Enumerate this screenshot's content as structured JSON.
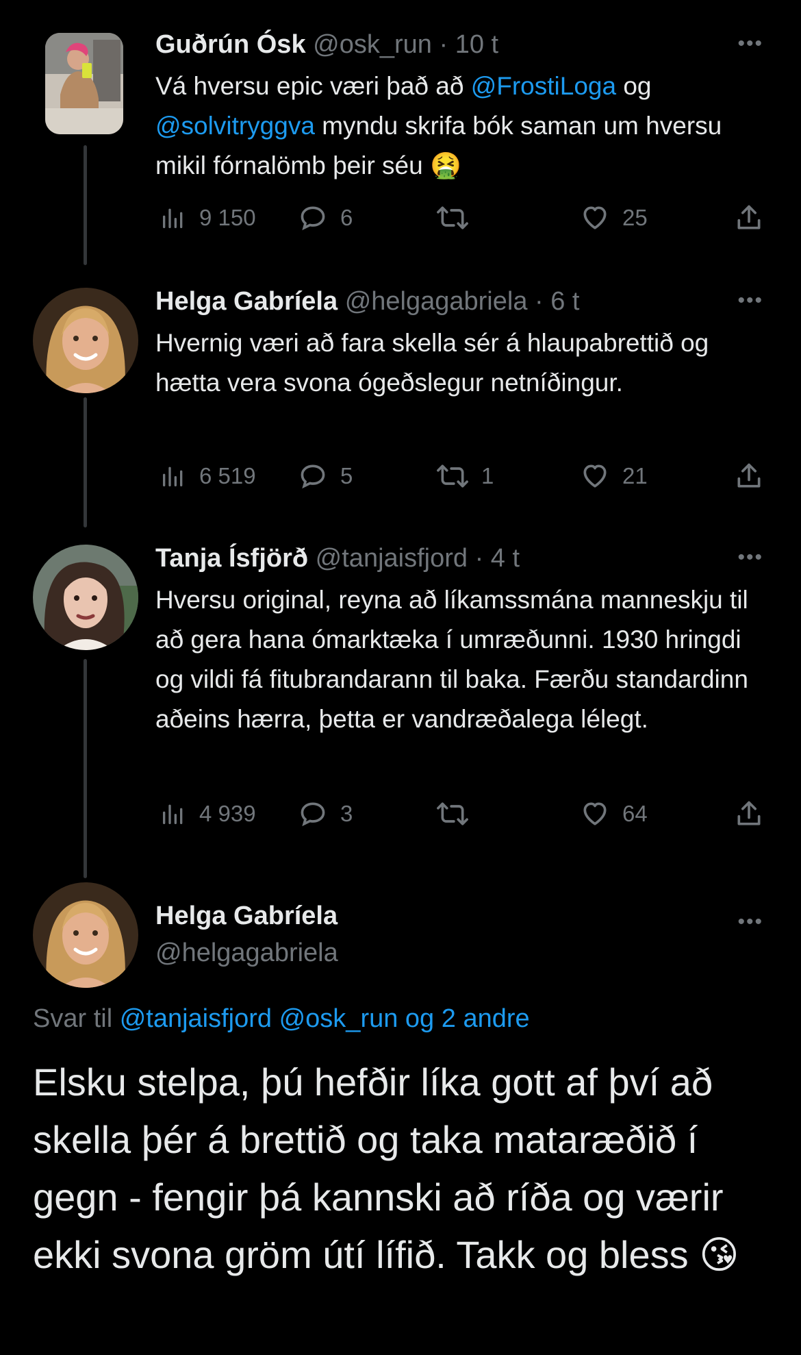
{
  "tweets": [
    {
      "name": "Guðrún Ósk",
      "handle": "@osk_run",
      "time": "10 t",
      "text_parts": [
        "Vá hversu epic væri það að ",
        "@FrostiLoga",
        " og ",
        "@solvitryggva",
        " myndu skrifa bók saman um hversu mikil fórnalömb þeir séu ",
        "🤮"
      ],
      "views": "9 150",
      "replies": "6",
      "retweets": "",
      "likes": "25"
    },
    {
      "name": "Helga Gabríela",
      "handle": "@helgagabriela",
      "time": "6 t",
      "text": "Hvernig væri að fara skella sér á hlaupabrettið og hætta vera svona ógeðslegur netníðingur.",
      "views": "6 519",
      "replies": "5",
      "retweets": "1",
      "likes": "21"
    },
    {
      "name": "Tanja Ísfjörð",
      "handle": "@tanjaisfjord",
      "time": "4 t",
      "text": "Hversu original, reyna að líkamssmána manneskju til að gera hana ómarktæka í umræðunni. 1930 hringdi og vildi fá fitubrandarann til baka. Færðu standardinn aðeins hærra, þetta er vandræðalega lélegt.",
      "views": "4 939",
      "replies": "3",
      "retweets": "",
      "likes": "64"
    }
  ],
  "main_tweet": {
    "name": "Helga Gabríela",
    "handle": "@helgagabriela",
    "reply_label": "Svar til",
    "reply_targets": "@tanjaisfjord @osk_run og 2 andre",
    "text": "Elsku stelpa, þú hefðir líka gott af því að skella þér á brettið og taka mataræðið í gegn - fengir þá kannski að ríða og værir ekki svona gröm útí lífið. Takk og bless",
    "emoji": "😘"
  },
  "icons": [
    "views-icon",
    "reply-icon",
    "retweet-icon",
    "like-icon",
    "share-icon",
    "more-icon"
  ],
  "colors": {
    "background": "#000000",
    "text": "#e7e9ea",
    "muted": "#71767b",
    "link": "#1d9bf0"
  }
}
